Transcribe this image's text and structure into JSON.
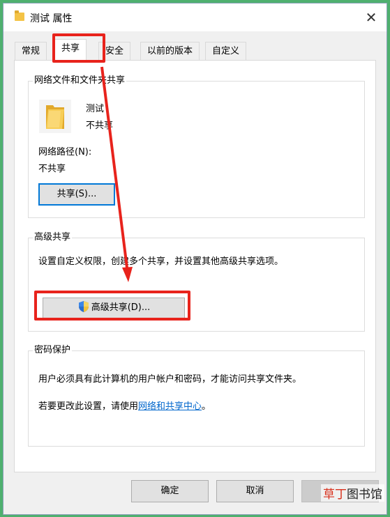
{
  "window": {
    "title": "测试 属性",
    "close_glyph": "✕"
  },
  "tabs": [
    {
      "label": "常规"
    },
    {
      "label": "共享"
    },
    {
      "label": "安全"
    },
    {
      "label": "以前的版本"
    },
    {
      "label": "自定义"
    }
  ],
  "network_share": {
    "legend": "网络文件和文件夹共享",
    "folder_name": "测试",
    "status": "不共享",
    "path_label": "网络路径(N):",
    "path_value": "不共享",
    "share_button": "共享(S)..."
  },
  "advanced_share": {
    "legend": "高级共享",
    "description": "设置自定义权限，创建多个共享，并设置其他高级共享选项。",
    "button": "高级共享(D)..."
  },
  "password": {
    "legend": "密码保护",
    "description": "用户必须具有此计算机的用户帐户和密码，才能访问共享文件夹。",
    "change_prefix": "若要更改此设置，请使用",
    "change_link": "网络和共享中心",
    "change_suffix": "。"
  },
  "footer": {
    "ok": "确定",
    "cancel": "取消"
  },
  "watermark": {
    "part1": "草丁",
    "part2": "图书馆"
  },
  "colors": {
    "highlight_red": "#e8231c",
    "link": "#0066cc",
    "background_green": "#4fb06f"
  }
}
